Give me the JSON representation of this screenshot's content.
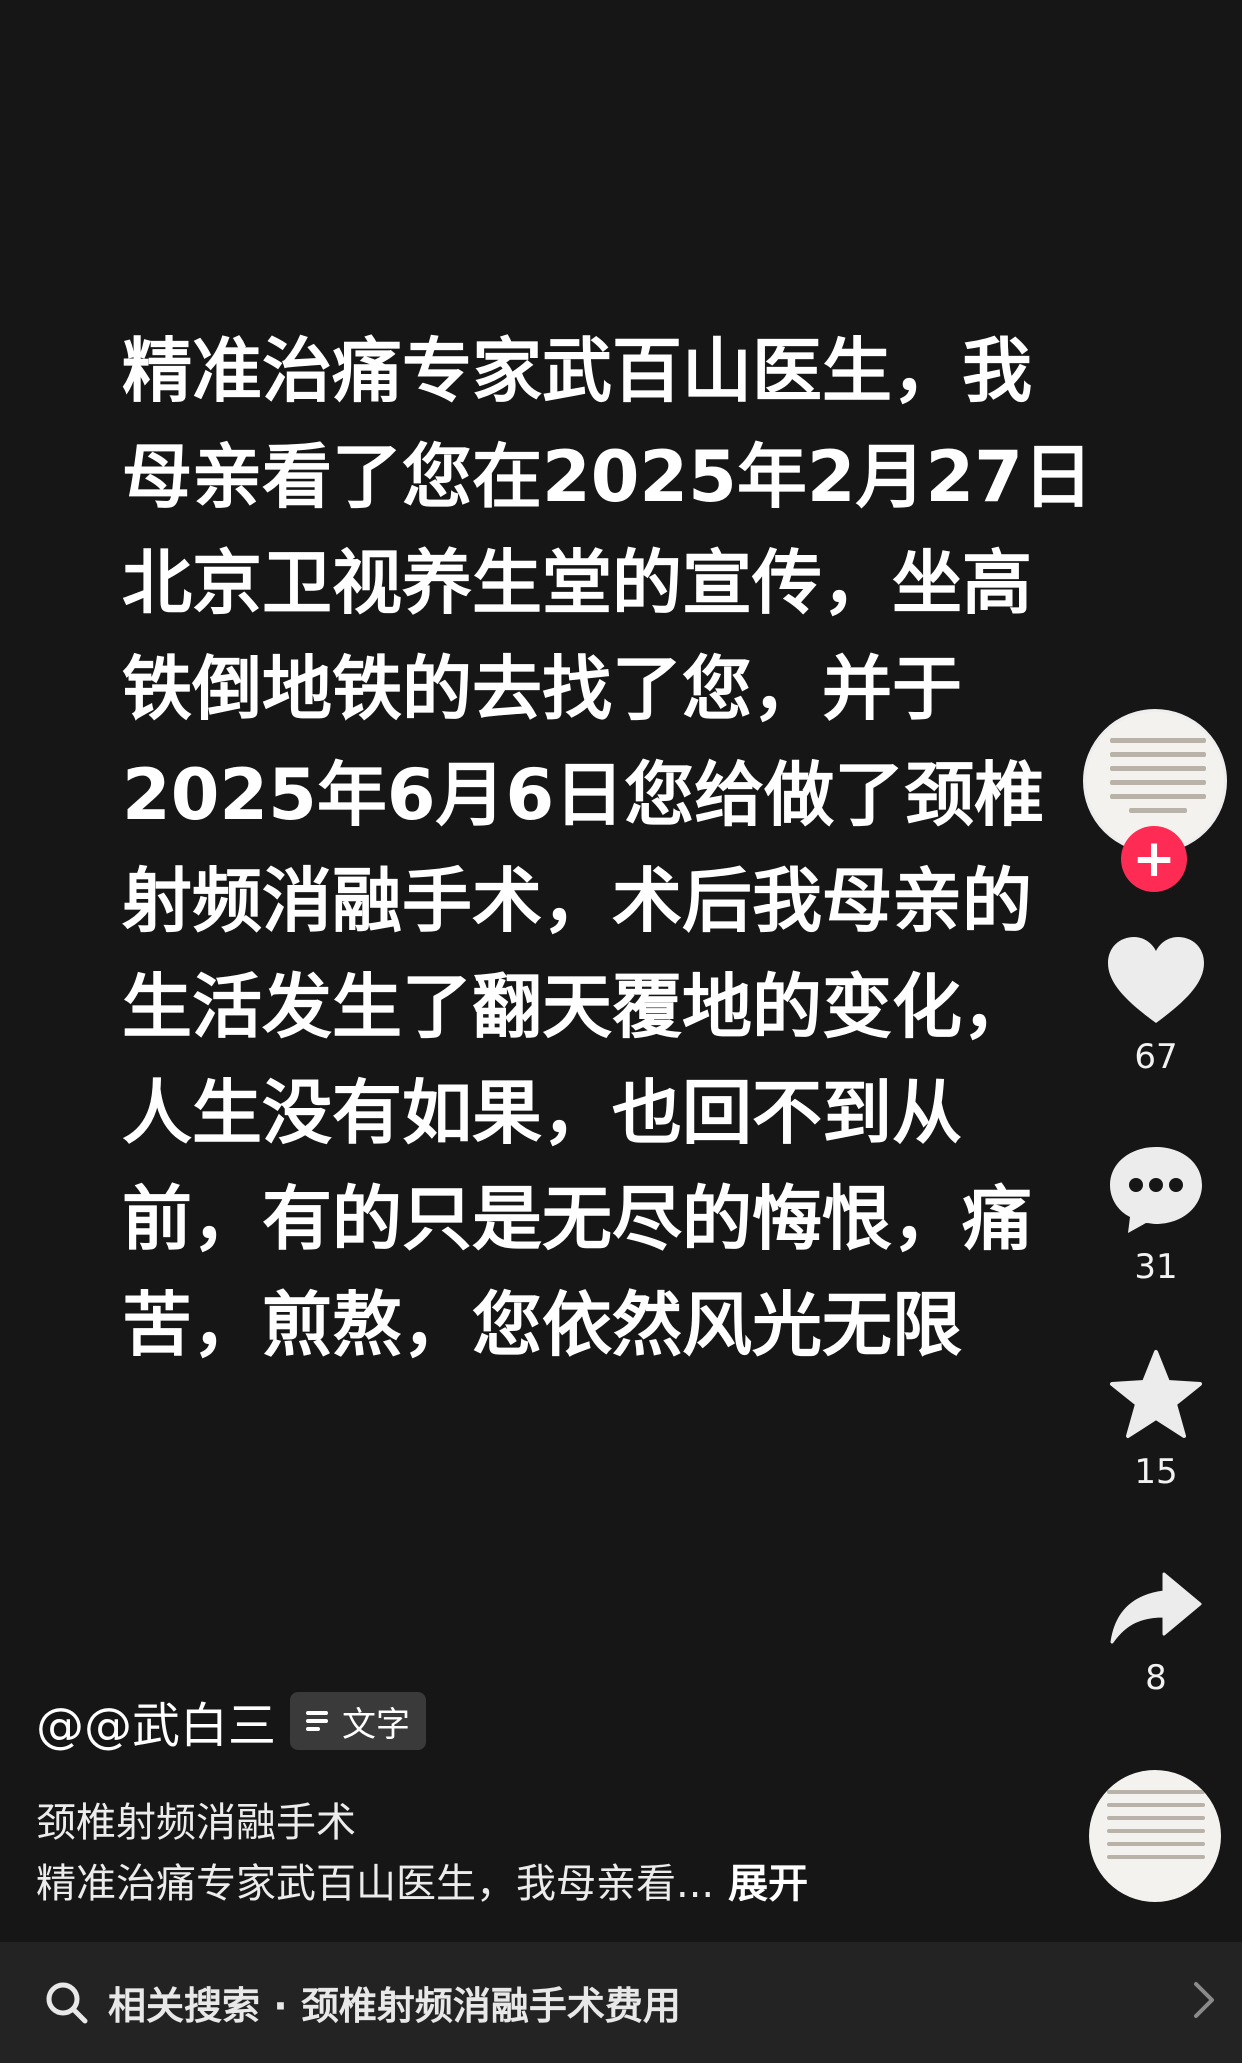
{
  "post": {
    "text": "精准治痛专家武百山医生，我\n母亲看了您在2025年2月27日\n北京卫视养生堂的宣传，坐高\n铁倒地铁的去找了您，并于\n2025年6月6日您给做了颈椎\n射频消融手术，术后我母亲的\n生活发生了翻天覆地的变化，\n人生没有如果，也回不到从\n前，有的只是无尽的悔恨，痛\n苦，煎熬，您依然风光无限"
  },
  "actions": {
    "likes": "67",
    "comments": "31",
    "favorites": "15",
    "shares": "8"
  },
  "author": {
    "handle": "@@武白三",
    "tag_label": "文字"
  },
  "caption": {
    "topic": "颈椎射频消融手术",
    "description": "精准治痛专家武百山医生，我母亲看...",
    "expand": "展开"
  },
  "related_search": {
    "label": "相关搜索 · 颈椎射频消融手术费用"
  },
  "colors": {
    "background": "#161616",
    "follow_accent": "#fe2c55",
    "search_bar": "#232323"
  }
}
